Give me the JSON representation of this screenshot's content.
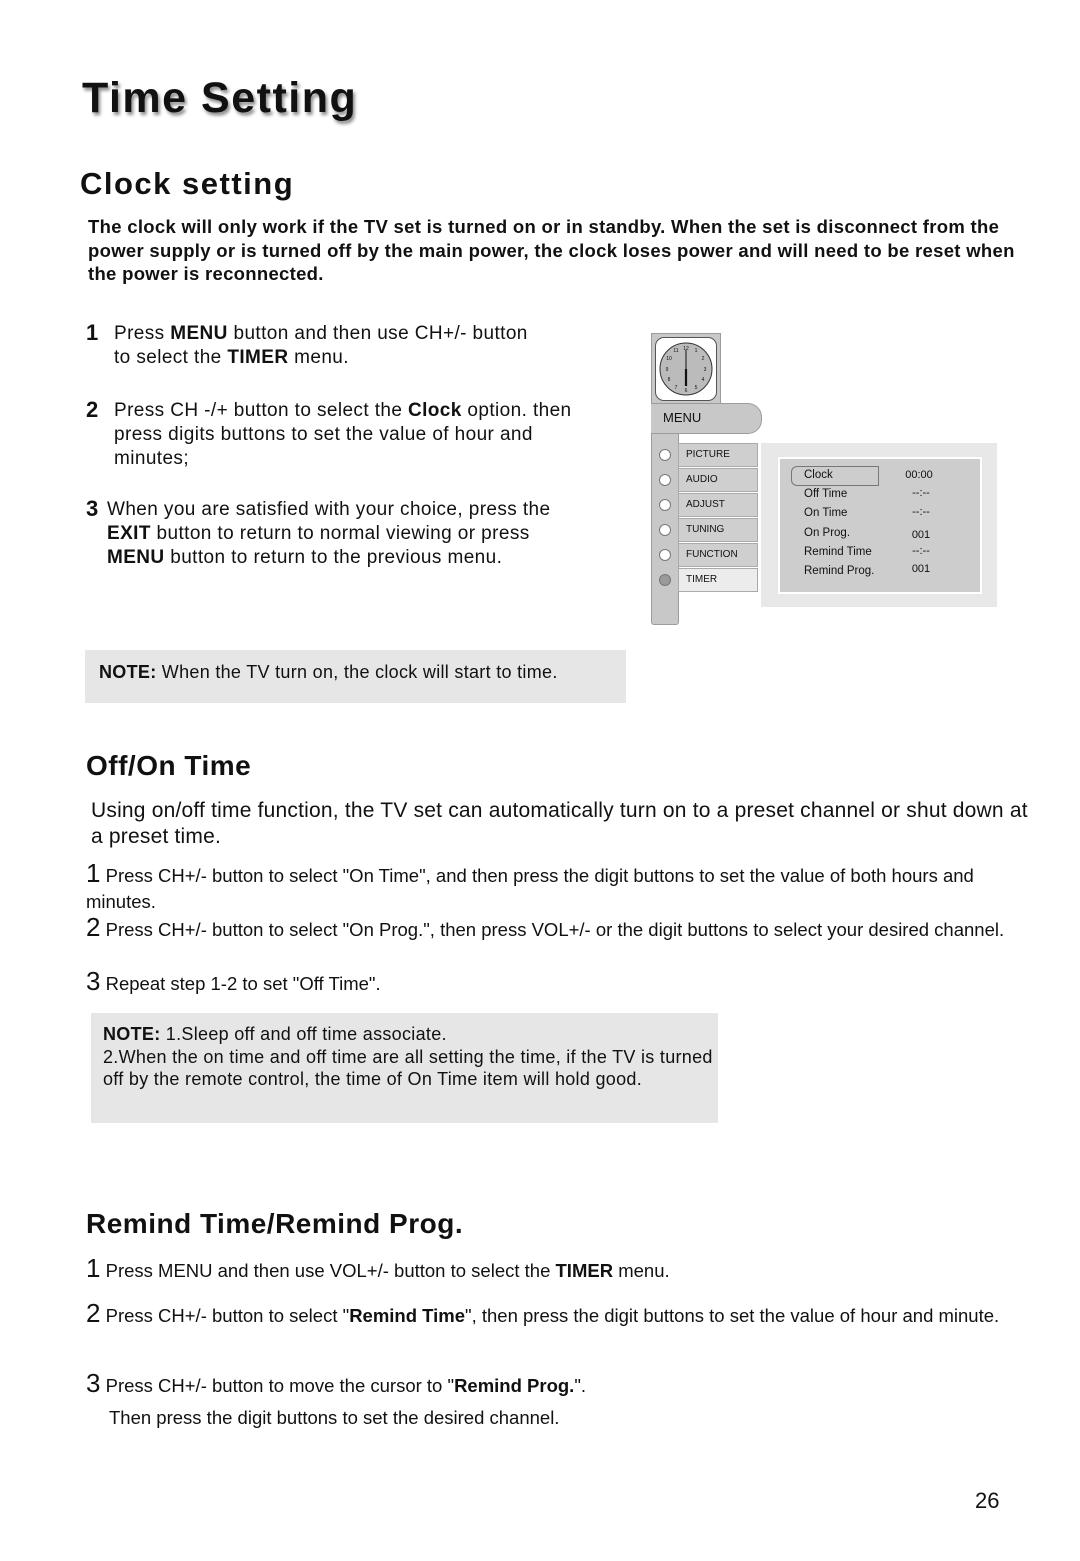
{
  "page": {
    "title": "Time Setting",
    "page_number": "26"
  },
  "clock_setting": {
    "heading": "Clock setting",
    "intro": "The clock will only work if the TV set is  turned on or in standby. When the set is disconnect from the power supply or is turned off by the main power, the clock loses power and will need to be reset when the power is reconnected.",
    "steps": [
      {
        "num": "1",
        "parts": [
          "Press ",
          "MENU",
          " button and then use CH+/- button to select the ",
          "TIMER",
          " menu."
        ]
      },
      {
        "num": "2",
        "parts": [
          "Press CH -/+ button to select the ",
          "Clock",
          " option. then press digits buttons to set the value of hour and minutes;"
        ]
      },
      {
        "num": "3",
        "parts": [
          "When you are satisfied with your choice, press the ",
          "EXIT",
          " button to return to normal viewing or press ",
          "MENU",
          " button to return to the previous menu."
        ]
      }
    ],
    "note_label": "NOTE:",
    "note_text": " When the TV turn on, the clock will start to time."
  },
  "tv_menu": {
    "menu_label": "MENU",
    "clock_icon": "analog-clock-icon",
    "items": [
      {
        "label": "PICTURE",
        "selected": false
      },
      {
        "label": "AUDIO",
        "selected": false
      },
      {
        "label": "ADJUST",
        "selected": false
      },
      {
        "label": "TUNING",
        "selected": false
      },
      {
        "label": "FUNCTION",
        "selected": false
      },
      {
        "label": "TIMER",
        "selected": true
      }
    ],
    "timer_rows": [
      {
        "label": "Clock",
        "value": "00:00"
      },
      {
        "label": "Off Time",
        "value": "--:--"
      },
      {
        "label": "On Time",
        "value": "--:--"
      },
      {
        "label": "On Prog.",
        "value": "001"
      },
      {
        "label": "Remind Time",
        "value": "--:--"
      },
      {
        "label": "Remind Prog.",
        "value": "001"
      }
    ]
  },
  "off_on_time": {
    "heading": "Off/On Time",
    "intro": "Using on/off time function, the TV set can automatically turn on to a preset channel or shut down at a preset time.",
    "steps": [
      {
        "num": "1",
        "text": "Press CH+/- button to select  \"On Time\", and then press the digit buttons to set the value of both hours and minutes."
      },
      {
        "num": "2",
        "text": "Press CH+/- button to select  \"On Prog.\", then press VOL+/- or the digit buttons to select your desired channel."
      },
      {
        "num": "3",
        "text": "Repeat step 1-2 to set \"Off Time\"."
      }
    ],
    "note_label": "NOTE:",
    "note_line1": " 1.Sleep off and off time associate.",
    "note_line2": "2.When the on time and off time are all setting the time, if the TV is turned off by the remote control, the time of On Time item will hold good."
  },
  "remind": {
    "heading": "Remind Time/Remind Prog.",
    "steps": [
      {
        "num": "1",
        "parts": [
          "Press MENU and then use VOL+/- button to select the ",
          "TIMER",
          " menu."
        ]
      },
      {
        "num": "2",
        "parts": [
          "Press CH+/- button to select  \"",
          "Remind Time",
          "\", then press the digit buttons to set the value of hour and minute."
        ]
      },
      {
        "num": "3",
        "parts": [
          "Press CH+/- button to move the cursor to \"",
          "Remind Prog.",
          "\"."
        ]
      }
    ],
    "step3_cont": "Then press the digit buttons to set the desired channel."
  }
}
